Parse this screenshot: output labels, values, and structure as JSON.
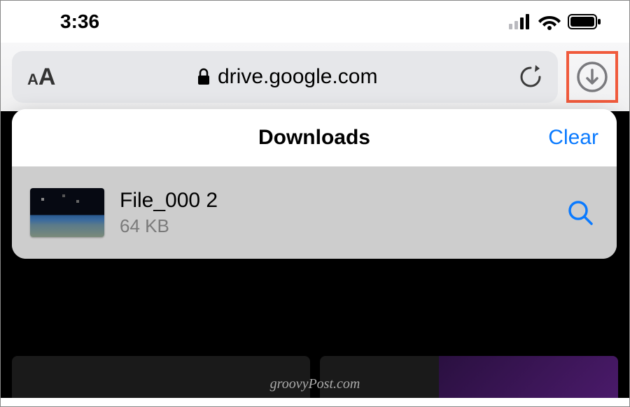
{
  "status": {
    "time": "3:36"
  },
  "toolbar": {
    "url": "drive.google.com"
  },
  "downloads_popover": {
    "title": "Downloads",
    "clear_label": "Clear",
    "items": [
      {
        "name": "File_000 2",
        "size": "64 KB"
      }
    ]
  },
  "watermark": "groovyPost.com"
}
